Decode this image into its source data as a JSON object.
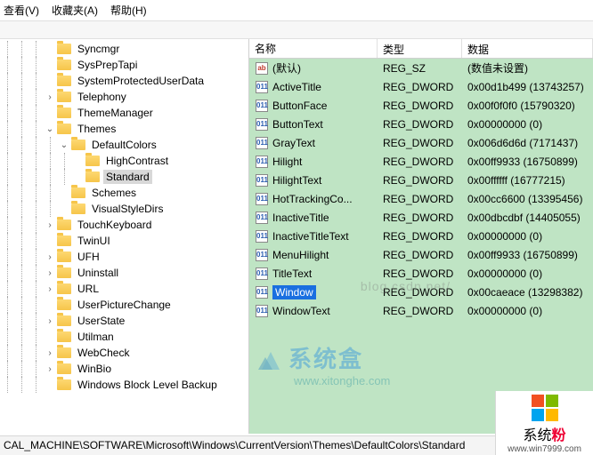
{
  "menus": {
    "view": "查看(V)",
    "fav": "收藏夹(A)",
    "help": "帮助(H)"
  },
  "tree": [
    {
      "d": 3,
      "exp": "",
      "label": "Syncmgr"
    },
    {
      "d": 3,
      "exp": "",
      "label": "SysPrepTapi"
    },
    {
      "d": 3,
      "exp": "",
      "label": "SystemProtectedUserData"
    },
    {
      "d": 3,
      "exp": ">",
      "label": "Telephony"
    },
    {
      "d": 3,
      "exp": "",
      "label": "ThemeManager"
    },
    {
      "d": 3,
      "exp": "v",
      "label": "Themes"
    },
    {
      "d": 4,
      "exp": "v",
      "label": "DefaultColors"
    },
    {
      "d": 5,
      "exp": "",
      "label": "HighContrast"
    },
    {
      "d": 5,
      "exp": "",
      "label": "Standard",
      "selected": true
    },
    {
      "d": 4,
      "exp": "",
      "label": "Schemes"
    },
    {
      "d": 4,
      "exp": "",
      "label": "VisualStyleDirs"
    },
    {
      "d": 3,
      "exp": ">",
      "label": "TouchKeyboard"
    },
    {
      "d": 3,
      "exp": "",
      "label": "TwinUI"
    },
    {
      "d": 3,
      "exp": ">",
      "label": "UFH"
    },
    {
      "d": 3,
      "exp": ">",
      "label": "Uninstall"
    },
    {
      "d": 3,
      "exp": ">",
      "label": "URL"
    },
    {
      "d": 3,
      "exp": "",
      "label": "UserPictureChange"
    },
    {
      "d": 3,
      "exp": ">",
      "label": "UserState"
    },
    {
      "d": 3,
      "exp": "",
      "label": "Utilman"
    },
    {
      "d": 3,
      "exp": ">",
      "label": "WebCheck"
    },
    {
      "d": 3,
      "exp": ">",
      "label": "WinBio"
    },
    {
      "d": 3,
      "exp": "",
      "label": "Windows Block Level Backup"
    }
  ],
  "columns": {
    "name": "名称",
    "type": "类型",
    "data": "数据"
  },
  "values": [
    {
      "icon": "str",
      "name": "(默认)",
      "type": "REG_SZ",
      "data": "(数值未设置)"
    },
    {
      "icon": "bin",
      "name": "ActiveTitle",
      "type": "REG_DWORD",
      "data": "0x00d1b499 (13743257)"
    },
    {
      "icon": "bin",
      "name": "ButtonFace",
      "type": "REG_DWORD",
      "data": "0x00f0f0f0 (15790320)"
    },
    {
      "icon": "bin",
      "name": "ButtonText",
      "type": "REG_DWORD",
      "data": "0x00000000 (0)"
    },
    {
      "icon": "bin",
      "name": "GrayText",
      "type": "REG_DWORD",
      "data": "0x006d6d6d (7171437)"
    },
    {
      "icon": "bin",
      "name": "Hilight",
      "type": "REG_DWORD",
      "data": "0x00ff9933 (16750899)"
    },
    {
      "icon": "bin",
      "name": "HilightText",
      "type": "REG_DWORD",
      "data": "0x00ffffff (16777215)"
    },
    {
      "icon": "bin",
      "name": "HotTrackingCo...",
      "type": "REG_DWORD",
      "data": "0x00cc6600 (13395456)"
    },
    {
      "icon": "bin",
      "name": "InactiveTitle",
      "type": "REG_DWORD",
      "data": "0x00dbcdbf (14405055)"
    },
    {
      "icon": "bin",
      "name": "InactiveTitleText",
      "type": "REG_DWORD",
      "data": "0x00000000 (0)"
    },
    {
      "icon": "bin",
      "name": "MenuHilight",
      "type": "REG_DWORD",
      "data": "0x00ff9933 (16750899)"
    },
    {
      "icon": "bin",
      "name": "TitleText",
      "type": "REG_DWORD",
      "data": "0x00000000 (0)"
    },
    {
      "icon": "bin",
      "name": "Window",
      "type": "REG_DWORD",
      "data": "0x00caeace (13298382)",
      "selected": true
    },
    {
      "icon": "bin",
      "name": "WindowText",
      "type": "REG_DWORD",
      "data": "0x00000000 (0)"
    }
  ],
  "status": "CAL_MACHINE\\SOFTWARE\\Microsoft\\Windows\\CurrentVersion\\Themes\\DefaultColors\\Standard",
  "watermark": {
    "title": "系统盒",
    "url": "www.xitonghe.com",
    "url2": "blog.csdn.net/"
  },
  "corner": {
    "title_a": "系统",
    "title_b": "粉",
    "url": "www.win7999.com"
  }
}
